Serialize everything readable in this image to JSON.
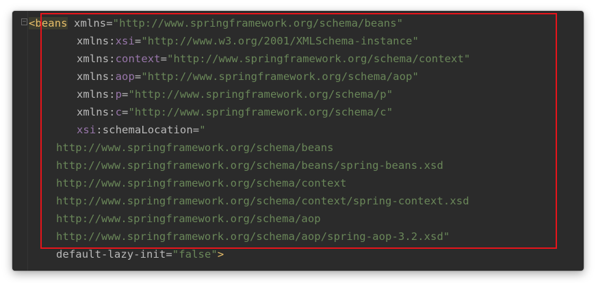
{
  "editor": {
    "colors": {
      "background": "#2b2b2b",
      "tag": "#e8bf6a",
      "attribute": "#bababa",
      "namespace_prefix": "#9876aa",
      "string": "#6a8759",
      "annotation_box": "#e8141b"
    },
    "lines": [
      {
        "tag_open": "<beans",
        "attr": "xmlns",
        "eq": "=",
        "value": "\"http://www.springframework.org/schema/beans\""
      },
      {
        "attr": "xmlns:",
        "ns": "xsi",
        "eq": "=",
        "value": "\"http://www.w3.org/2001/XMLSchema-instance\""
      },
      {
        "attr": "xmlns:",
        "ns": "context",
        "eq": "=",
        "value": "\"http://www.springframework.org/schema/context\""
      },
      {
        "attr": "xmlns:",
        "ns": "aop",
        "eq": "=",
        "value": "\"http://www.springframework.org/schema/aop\""
      },
      {
        "attr": "xmlns:",
        "ns": "p",
        "eq": "=",
        "value": "\"http://www.springframework.org/schema/p\""
      },
      {
        "attr": "xmlns:",
        "ns": "c",
        "eq": "=",
        "value": "\"http://www.springframework.org/schema/c\""
      },
      {
        "ns": "xsi",
        "attr": ":schemaLocation",
        "eq": "=",
        "value": "\""
      },
      {
        "value": "http://www.springframework.org/schema/beans"
      },
      {
        "value": "http://www.springframework.org/schema/beans/spring-beans.xsd"
      },
      {
        "value": "http://www.springframework.org/schema/context"
      },
      {
        "value": "http://www.springframework.org/schema/context/spring-context.xsd"
      },
      {
        "value": "http://www.springframework.org/schema/aop"
      },
      {
        "value": "http://www.springframework.org/schema/aop/spring-aop-3.2.xsd\""
      },
      {
        "attr": "default-lazy-init",
        "eq": "=",
        "value": "\"false\"",
        "tag_close": ">"
      }
    ],
    "fold_icon": "fold-minus-icon"
  }
}
